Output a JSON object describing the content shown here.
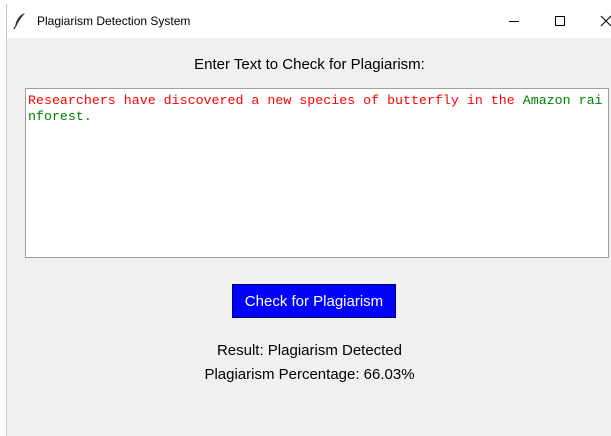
{
  "window": {
    "title": "Plagiarism Detection System",
    "icon": "feather-icon",
    "controls": [
      "minimize-icon",
      "maximize-icon",
      "close-icon"
    ]
  },
  "main": {
    "prompt": "Enter Text to Check for Plagiarism:",
    "text_input": {
      "tokens": [
        {
          "text": "Researchers have discovered a new species of butterfly in the ",
          "color": "#ff0000"
        },
        {
          "text": "Amazon rainforest.",
          "color": "#008000"
        }
      ]
    },
    "check_button_label": "Check for Plagiarism",
    "check_button_color": "#0000ff",
    "result_text": "Result: Plagiarism Detected",
    "percentage_text": "Plagiarism Percentage: 66.03%"
  }
}
